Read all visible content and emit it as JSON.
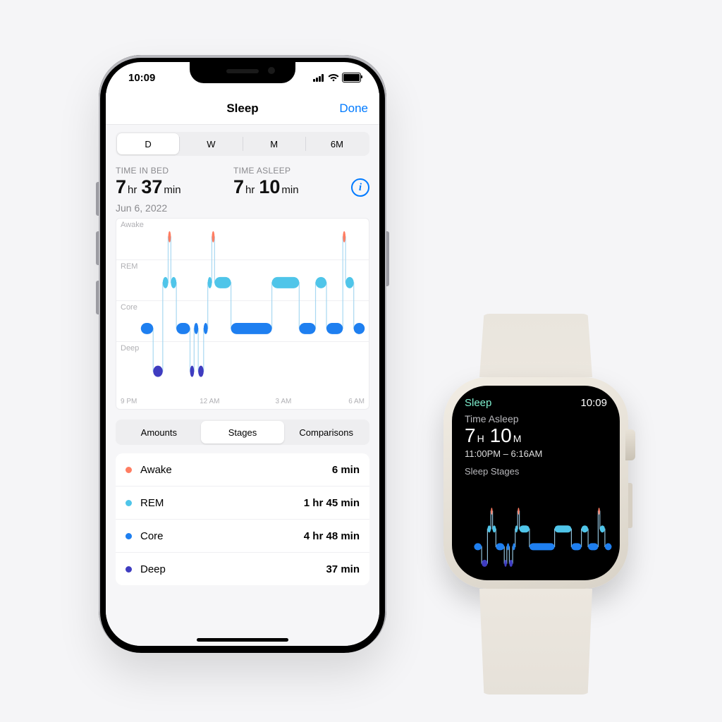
{
  "phone": {
    "status_time": "10:09",
    "nav": {
      "title": "Sleep",
      "done": "Done"
    },
    "range_tabs": [
      "D",
      "W",
      "M",
      "6M"
    ],
    "range_selected": 0,
    "metrics": {
      "bed": {
        "label": "TIME IN BED",
        "h": "7",
        "h_unit": "hr",
        "m": "37",
        "m_unit": "min"
      },
      "asleep": {
        "label": "TIME ASLEEP",
        "h": "7",
        "h_unit": "hr",
        "m": "10",
        "m_unit": "min"
      }
    },
    "date": "Jun 6, 2022",
    "chart": {
      "stage_labels": [
        "Awake",
        "REM",
        "Core",
        "Deep"
      ],
      "x_labels": [
        "9 PM",
        "12 AM",
        "3 AM",
        "6 AM"
      ]
    },
    "view_tabs": [
      "Amounts",
      "Stages",
      "Comparisons"
    ],
    "view_selected": 1,
    "stages": [
      {
        "dot": "#ff7d62",
        "name": "Awake",
        "dur": "6 min"
      },
      {
        "dot": "#4fc5e9",
        "name": "REM",
        "dur": "1 hr 45 min"
      },
      {
        "dot": "#1e7ff0",
        "name": "Core",
        "dur": "4 hr 48 min"
      },
      {
        "dot": "#3f3cc0",
        "name": "Deep",
        "dur": "37 min"
      }
    ]
  },
  "watch": {
    "title": "Sleep",
    "time": "10:09",
    "asleep_label": "Time Asleep",
    "asleep_h": "7",
    "asleep_h_unit": "H",
    "asleep_m": "10",
    "asleep_m_unit": "M",
    "range": "11:00PM – 6:16AM",
    "stages_label": "Sleep Stages"
  },
  "chart_data": {
    "type": "bar",
    "note": "Sleep-stage hypnogram; x is time-of-night, y is stage lane (4=Awake,3=REM,2=Core,1=Deep). Each segment is a contiguous block in one stage.",
    "x_range_hours": [
      21,
      30.25
    ],
    "stage_order": [
      "Deep",
      "Core",
      "REM",
      "Awake"
    ],
    "colors": {
      "Awake": "#ff7d62",
      "REM": "#4fc5e9",
      "Core": "#1e7ff0",
      "Deep": "#3f3cc0"
    },
    "segments": [
      {
        "stage": "Core",
        "start": 21.9,
        "end": 22.35
      },
      {
        "stage": "Deep",
        "start": 22.35,
        "end": 22.7
      },
      {
        "stage": "REM",
        "start": 22.7,
        "end": 22.9
      },
      {
        "stage": "Awake",
        "start": 22.9,
        "end": 23.0
      },
      {
        "stage": "REM",
        "start": 23.0,
        "end": 23.2
      },
      {
        "stage": "Core",
        "start": 23.2,
        "end": 23.7
      },
      {
        "stage": "Deep",
        "start": 23.7,
        "end": 23.85
      },
      {
        "stage": "Core",
        "start": 23.85,
        "end": 24.0
      },
      {
        "stage": "Deep",
        "start": 24.0,
        "end": 24.2
      },
      {
        "stage": "Core",
        "start": 24.2,
        "end": 24.35
      },
      {
        "stage": "REM",
        "start": 24.35,
        "end": 24.5
      },
      {
        "stage": "Awake",
        "start": 24.5,
        "end": 24.6
      },
      {
        "stage": "REM",
        "start": 24.6,
        "end": 25.2
      },
      {
        "stage": "Core",
        "start": 25.2,
        "end": 26.7
      },
      {
        "stage": "REM",
        "start": 26.7,
        "end": 27.7
      },
      {
        "stage": "Core",
        "start": 27.7,
        "end": 28.3
      },
      {
        "stage": "REM",
        "start": 28.3,
        "end": 28.7
      },
      {
        "stage": "Core",
        "start": 28.7,
        "end": 29.3
      },
      {
        "stage": "Awake",
        "start": 29.3,
        "end": 29.4
      },
      {
        "stage": "REM",
        "start": 29.4,
        "end": 29.7
      },
      {
        "stage": "Core",
        "start": 29.7,
        "end": 30.1
      }
    ],
    "totals_minutes": {
      "Awake": 6,
      "REM": 105,
      "Core": 288,
      "Deep": 37
    }
  }
}
